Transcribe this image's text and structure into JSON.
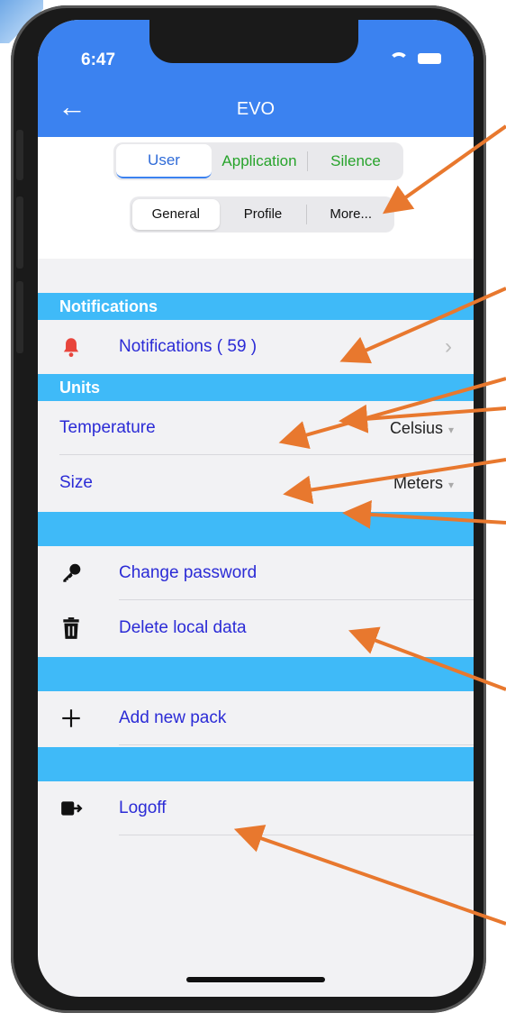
{
  "status": {
    "time": "6:47"
  },
  "nav": {
    "title": "EVO"
  },
  "tabs_primary": {
    "user": "User",
    "application": "Application",
    "silence": "Silence"
  },
  "tabs_secondary": {
    "general": "General",
    "profile": "Profile",
    "more": "More..."
  },
  "sections": {
    "notifications_header": "Notifications",
    "units_header": "Units"
  },
  "notifications": {
    "label": "Notifications ( 59 )"
  },
  "units": {
    "temperature_label": "Temperature",
    "temperature_value": "Celsius",
    "size_label": "Size",
    "size_value": "Meters"
  },
  "actions": {
    "change_password": "Change password",
    "delete_local_data": "Delete local data",
    "add_new_pack": "Add new pack",
    "logoff": "Logoff"
  },
  "icons": {
    "bell": "bell-icon",
    "key": "key-icon",
    "trash": "trash-icon",
    "plus": "plus-icon",
    "logout": "logout-icon"
  },
  "colors": {
    "navbar": "#3b82f0",
    "section": "#3fbaf8",
    "link": "#2b2bd6",
    "tab_green": "#27a32b",
    "bell": "#e8453c",
    "annotation_arrow": "#e8782e"
  }
}
